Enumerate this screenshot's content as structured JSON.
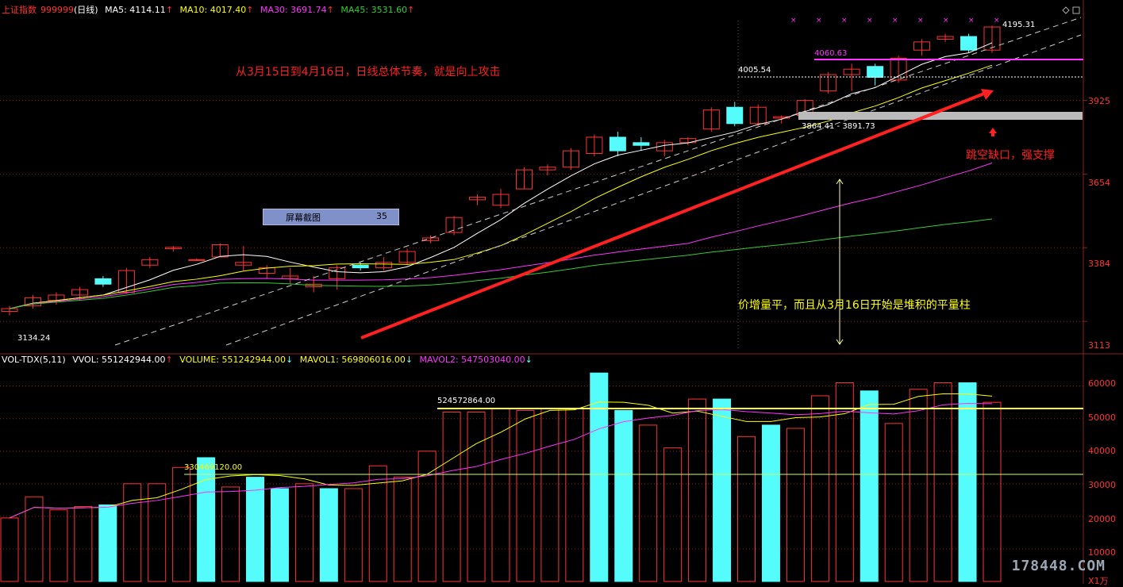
{
  "header": {
    "index_name": "上证指数",
    "code": "999999",
    "period": "(日线)",
    "ma5": "MA5: 4114.11",
    "ma10": "MA10: 4017.40",
    "ma30": "MA30: 3691.74",
    "ma45": "MA45: 3531.60",
    "up_arrow": "↑",
    "down_arrow": "↓"
  },
  "vol_header": {
    "name": "VOL-TDX(5,11)",
    "vvol": "VVOL: 551242944.00",
    "volume": "VOLUME: 551242944.00",
    "mavol1": "MAVOL1: 569806016.00",
    "mavol2": "MAVOL2: 547503040.00"
  },
  "annotations": {
    "top_note": "从3月15日到4月16日，日线总体节奏，就是向上攻击",
    "gap_note": "跳空缺口，强支撑",
    "vol_note": "价增量平，而且从3月16日开始是堆积的平量柱",
    "high_label": "4195.31",
    "low_label": "3134.24",
    "level_4060": "4060.63",
    "level_4005": "4005.54",
    "gap_range": "3864.41 - 3891.73",
    "vol_level_high": "524572864.00",
    "vol_level_low": "330469120.00",
    "screenshot_btn": "屏幕截图",
    "screenshot_num": "35",
    "unit": "X1万",
    "watermark": "178448.COM"
  },
  "colors": {
    "up": "#ff3333",
    "down": "#54fcfc",
    "ma5": "#ffffff",
    "ma10": "#ffff00",
    "ma30": "#ff33ff",
    "ma45": "#33cc33",
    "grid": "#882222",
    "trendline": "#ff2020"
  },
  "chart_data": [
    {
      "type": "candlestick",
      "title": "上证指数 999999 (日线)",
      "y_ticks": [
        3113,
        3384,
        3654,
        3925
      ],
      "ylim": [
        3113,
        4195
      ],
      "ohlc": [
        [
          3150,
          3170,
          3135,
          3160
        ],
        [
          3170,
          3210,
          3160,
          3200
        ],
        [
          3190,
          3220,
          3175,
          3210
        ],
        [
          3210,
          3240,
          3190,
          3230
        ],
        [
          3270,
          3280,
          3240,
          3250
        ],
        [
          3220,
          3310,
          3215,
          3300
        ],
        [
          3320,
          3350,
          3310,
          3340
        ],
        [
          3380,
          3390,
          3370,
          3385
        ],
        [
          3340,
          3345,
          3335,
          3340
        ],
        [
          3350,
          3400,
          3350,
          3395
        ],
        [
          3320,
          3390,
          3300,
          3330
        ],
        [
          3290,
          3320,
          3270,
          3310
        ],
        [
          3270,
          3310,
          3250,
          3280
        ],
        [
          3240,
          3280,
          3220,
          3250
        ],
        [
          3270,
          3320,
          3230,
          3310
        ],
        [
          3320,
          3330,
          3300,
          3310
        ],
        [
          3310,
          3350,
          3300,
          3330
        ],
        [
          3330,
          3380,
          3320,
          3370
        ],
        [
          3410,
          3430,
          3400,
          3420
        ],
        [
          3440,
          3500,
          3430,
          3495
        ],
        [
          3560,
          3580,
          3540,
          3570
        ],
        [
          3540,
          3600,
          3530,
          3580
        ],
        [
          3600,
          3680,
          3600,
          3670
        ],
        [
          3670,
          3690,
          3650,
          3680
        ],
        [
          3680,
          3750,
          3670,
          3740
        ],
        [
          3730,
          3800,
          3720,
          3790
        ],
        [
          3790,
          3810,
          3720,
          3740
        ],
        [
          3770,
          3790,
          3740,
          3760
        ],
        [
          3740,
          3780,
          3720,
          3770
        ],
        [
          3770,
          3790,
          3760,
          3785
        ],
        [
          3820,
          3900,
          3810,
          3890
        ],
        [
          3900,
          3920,
          3830,
          3840
        ],
        [
          3840,
          3910,
          3830,
          3900
        ],
        [
          3860,
          3870,
          3840,
          3865
        ],
        [
          3870,
          3930,
          3860,
          3925
        ],
        [
          3960,
          4030,
          3950,
          4020
        ],
        [
          4020,
          4060,
          3960,
          4040
        ],
        [
          4050,
          4060,
          3980,
          4010
        ],
        [
          4000,
          4090,
          3990,
          4080
        ],
        [
          4110,
          4150,
          4090,
          4140
        ],
        [
          4150,
          4170,
          4140,
          4160
        ],
        [
          4160,
          4170,
          4100,
          4110
        ],
        [
          4110,
          4200,
          4100,
          4195
        ]
      ],
      "ma5_label": "MA5: 4114.11",
      "ma10_label": "MA10: 4017.40",
      "ma30_label": "MA30: 3691.74",
      "ma45_label": "MA45: 3531.60"
    },
    {
      "type": "bar",
      "title": "VOL-TDX(5,11)",
      "unit": "X1万",
      "y_ticks": [
        10000,
        20000,
        30000,
        40000,
        50000,
        60000
      ],
      "ylim": [
        0,
        66000
      ],
      "volumes": [
        19500,
        26000,
        22000,
        23000,
        23500,
        30000,
        30000,
        35000,
        38000,
        29000,
        32000,
        28500,
        30000,
        28500,
        28500,
        35500,
        32000,
        40000,
        52000,
        52000,
        53000,
        52500,
        53000,
        53000,
        64000,
        52500,
        48000,
        41000,
        56000,
        56000,
        44500,
        48000,
        47000,
        57000,
        61000,
        58500,
        48500,
        59000,
        61000,
        61000,
        55000
      ],
      "up": [
        1,
        1,
        1,
        1,
        0,
        1,
        1,
        1,
        0,
        1,
        0,
        0,
        1,
        0,
        1,
        1,
        1,
        1,
        1,
        1,
        1,
        1,
        1,
        1,
        0,
        0,
        1,
        1,
        1,
        0,
        1,
        0,
        1,
        1,
        1,
        0,
        1,
        1,
        1,
        0,
        1
      ],
      "vvol_label": "VVOL: 551242944.00",
      "volume_label": "VOLUME: 551242944.00",
      "mavol1_label": "MAVOL1: 569806016.00",
      "mavol2_label": "MAVOL2: 547503040.00"
    }
  ]
}
